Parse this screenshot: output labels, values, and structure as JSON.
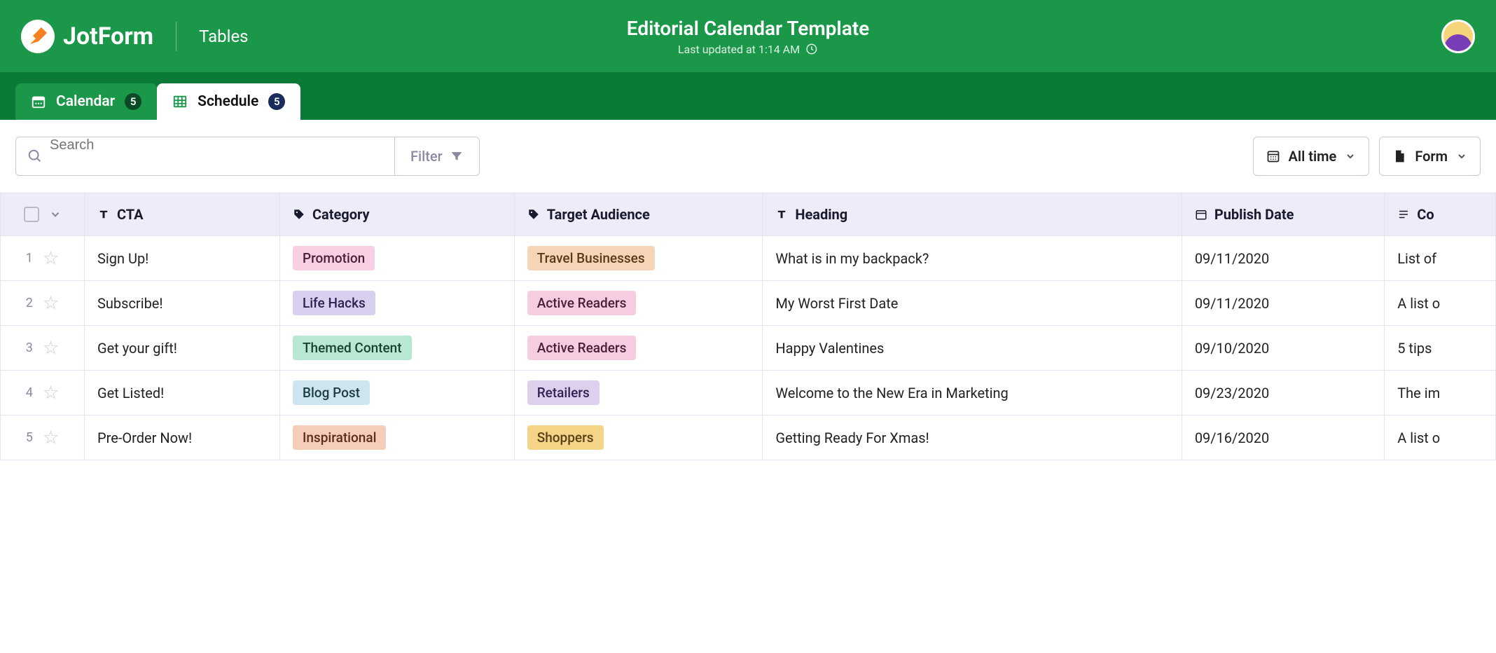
{
  "header": {
    "brand": "JotForm",
    "app_name": "Tables",
    "title": "Editorial Calendar Template",
    "last_updated": "Last updated at 1:14 AM"
  },
  "tabs": [
    {
      "label": "Calendar",
      "count": "5",
      "active": false
    },
    {
      "label": "Schedule",
      "count": "5",
      "active": true
    }
  ],
  "toolbar": {
    "search_placeholder": "Search",
    "filter_label": "Filter",
    "time_label": "All time",
    "form_label": "Form"
  },
  "columns": {
    "cta": "CTA",
    "category": "Category",
    "audience": "Target Audience",
    "heading": "Heading",
    "publish": "Publish Date",
    "content": "Co"
  },
  "rows": [
    {
      "idx": "1",
      "cta": "Sign Up!",
      "category": {
        "label": "Promotion",
        "color": "pink"
      },
      "audience": {
        "label": "Travel Businesses",
        "color": "peach"
      },
      "heading": "What is in my backpack?",
      "publish": "09/11/2020",
      "content": "List of"
    },
    {
      "idx": "2",
      "cta": "Subscribe!",
      "category": {
        "label": "Life Hacks",
        "color": "purple"
      },
      "audience": {
        "label": "Active Readers",
        "color": "pinklight"
      },
      "heading": "My Worst First Date",
      "publish": "09/11/2020",
      "content": "A list o"
    },
    {
      "idx": "3",
      "cta": "Get your gift!",
      "category": {
        "label": "Themed Content",
        "color": "teal"
      },
      "audience": {
        "label": "Active Readers",
        "color": "pinklight"
      },
      "heading": "Happy Valentines",
      "publish": "09/10/2020",
      "content": "5 tips"
    },
    {
      "idx": "4",
      "cta": "Get Listed!",
      "category": {
        "label": "Blog Post",
        "color": "lightblue"
      },
      "audience": {
        "label": "Retailers",
        "color": "lavender"
      },
      "heading": "Welcome to the New Era in Marketing",
      "publish": "09/23/2020",
      "content": "The im"
    },
    {
      "idx": "5",
      "cta": "Pre-Order Now!",
      "category": {
        "label": "Inspirational",
        "color": "orange"
      },
      "audience": {
        "label": "Shoppers",
        "color": "amber"
      },
      "heading": "Getting Ready For Xmas!",
      "publish": "09/16/2020",
      "content": "A list o"
    }
  ]
}
